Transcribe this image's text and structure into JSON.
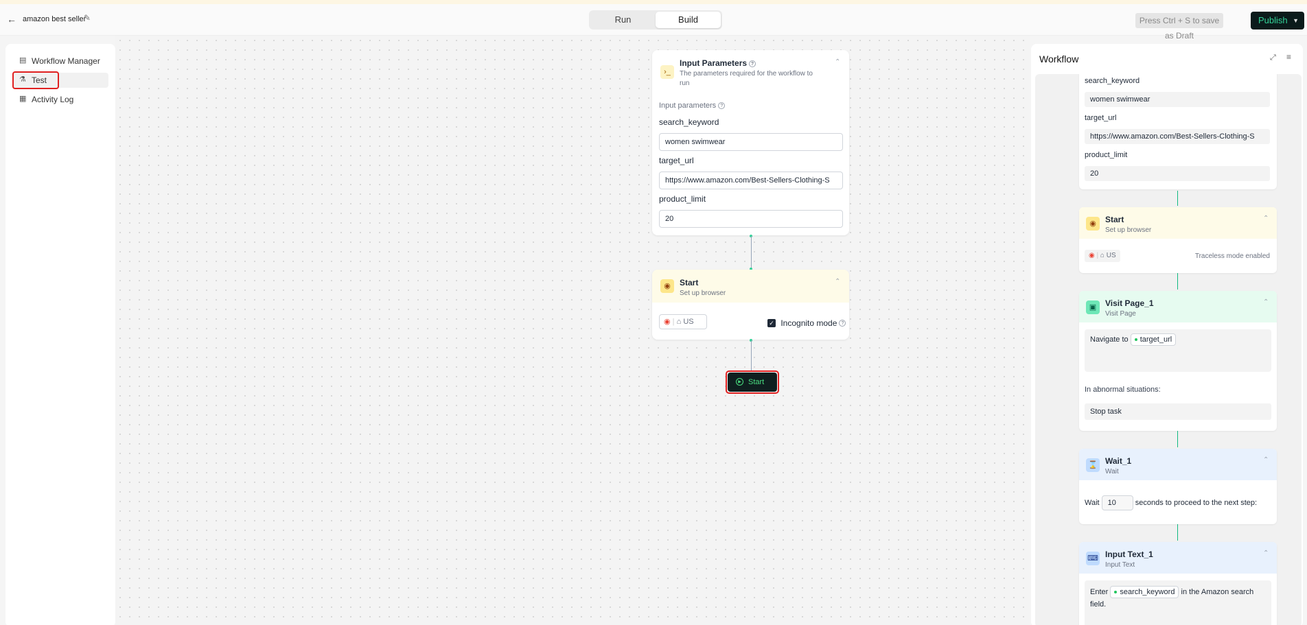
{
  "header": {
    "title": "amazon best seller",
    "modes": [
      "Run",
      "Build"
    ],
    "active_mode": "Build",
    "draft_hint": "Press Ctrl + S to save as Draft",
    "publish_label": "Publish"
  },
  "sidebar": {
    "items": [
      {
        "label": "Workflow Manager",
        "icon": "database-icon"
      },
      {
        "label": "Test",
        "icon": "flask-icon"
      },
      {
        "label": "Activity Log",
        "icon": "table-icon"
      }
    ]
  },
  "canvas": {
    "input_card": {
      "title": "Input Parameters",
      "subtitle": "The parameters required for the workflow to run",
      "section_label": "Input parameters",
      "fields": [
        {
          "label": "search_keyword",
          "value": "women swimwear"
        },
        {
          "label": "target_url",
          "value": "https://www.amazon.com/Best-Sellers-Clothing-S"
        },
        {
          "label": "product_limit",
          "value": "20"
        }
      ]
    },
    "start_card": {
      "title": "Start",
      "subtitle": "Set up browser",
      "region": "US",
      "incognito_label": "Incognito mode",
      "incognito_checked": true
    },
    "start_button": "Start"
  },
  "panel": {
    "title": "Workflow",
    "fields": [
      {
        "label": "search_keyword",
        "value": "women swimwear"
      },
      {
        "label": "target_url",
        "value": "https://www.amazon.com/Best-Sellers-Clothing-S"
      },
      {
        "label": "product_limit",
        "value": "20"
      }
    ],
    "start": {
      "title": "Start",
      "subtitle": "Set up browser",
      "region": "US",
      "traceless": "Traceless mode enabled"
    },
    "visit": {
      "title": "Visit Page_1",
      "subtitle": "Visit Page",
      "navigate": "Navigate to",
      "chip": "target_url",
      "abnormal_label": "In abnormal situations:",
      "abnormal_value": "Stop task"
    },
    "wait": {
      "title": "Wait_1",
      "subtitle": "Wait",
      "prefix": "Wait",
      "seconds": "10",
      "suffix": "seconds to proceed to the next step:"
    },
    "input_text": {
      "title": "Input Text_1",
      "subtitle": "Input Text",
      "prefix": "Enter",
      "chip": "search_keyword",
      "suffix": "in the Amazon search field."
    }
  },
  "colors": {
    "accent_green": "#34d399",
    "highlight_red": "#e02020",
    "start_header": "#fefbe8",
    "visit_header": "#e6fbf0",
    "wait_header": "#e8f1fd"
  }
}
